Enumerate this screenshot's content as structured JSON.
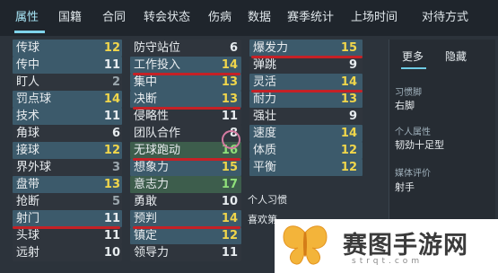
{
  "tabs": [
    "属性",
    "国籍",
    "合同",
    "转会状态",
    "伤病",
    "数据",
    "赛季统计",
    "上场时间",
    "对待方式"
  ],
  "col1": [
    {
      "name": "传球",
      "val": "12"
    },
    {
      "name": "传中",
      "val": "11"
    },
    {
      "name": "盯人",
      "val": "2"
    },
    {
      "name": "罚点球",
      "val": "14"
    },
    {
      "name": "技术",
      "val": "11"
    },
    {
      "name": "角球",
      "val": "6"
    },
    {
      "name": "接球",
      "val": "12"
    },
    {
      "name": "界外球",
      "val": "3"
    },
    {
      "name": "盘带",
      "val": "13"
    },
    {
      "name": "抢断",
      "val": "5"
    },
    {
      "name": "射门",
      "val": "11"
    },
    {
      "name": "头球",
      "val": "11"
    },
    {
      "name": "远射",
      "val": "10"
    }
  ],
  "col2": [
    {
      "name": "防守站位",
      "val": "6"
    },
    {
      "name": "工作投入",
      "val": "14"
    },
    {
      "name": "集中",
      "val": "13"
    },
    {
      "name": "决断",
      "val": "13"
    },
    {
      "name": "侵略性",
      "val": "11"
    },
    {
      "name": "团队合作",
      "val": "8"
    },
    {
      "name": "无球跑动",
      "val": "16"
    },
    {
      "name": "想象力",
      "val": "15"
    },
    {
      "name": "意志力",
      "val": "17"
    },
    {
      "name": "勇敢",
      "val": "10"
    },
    {
      "name": "预判",
      "val": "14"
    },
    {
      "name": "镇定",
      "val": "12"
    },
    {
      "name": "领导力",
      "val": "11"
    }
  ],
  "col3": [
    {
      "name": "爆发力",
      "val": "15"
    },
    {
      "name": "弹跳",
      "val": "9"
    },
    {
      "name": "灵活",
      "val": "14"
    },
    {
      "name": "耐力",
      "val": "13"
    },
    {
      "name": "强壮",
      "val": "9"
    },
    {
      "name": "速度",
      "val": "14"
    },
    {
      "name": "体质",
      "val": "12"
    },
    {
      "name": "平衡",
      "val": "12"
    }
  ],
  "side": {
    "more": "更多",
    "hide": "隐藏",
    "foot_label": "习惯脚",
    "foot_value": "右脚",
    "personality_label": "个人属性",
    "personality_value": "韧劲十足型",
    "media_label": "媒体评价",
    "media_value": "射手"
  },
  "info": {
    "habit_label": "个人习惯",
    "habit_value": "喜欢第"
  },
  "watermark": {
    "title": "赛图手游网",
    "sub": "strqt.com"
  }
}
